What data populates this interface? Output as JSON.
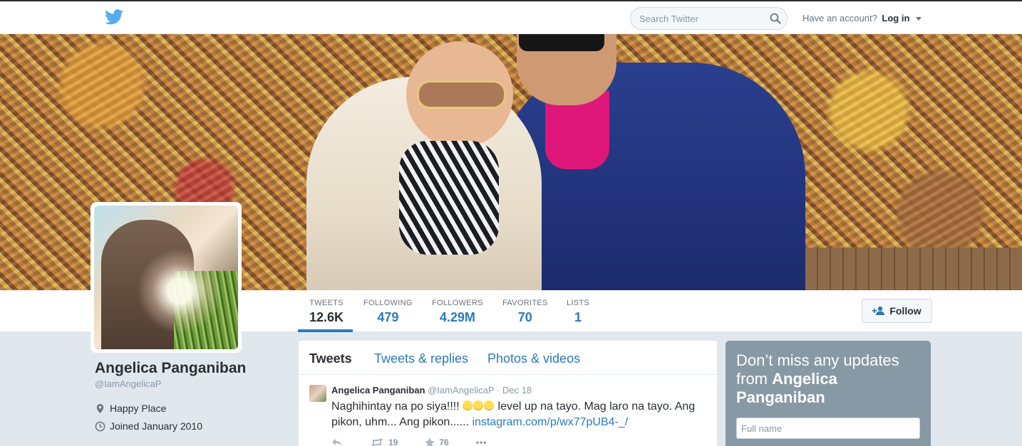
{
  "nav": {
    "search_placeholder": "Search Twitter",
    "have_account": "Have an account?",
    "login": "Log in"
  },
  "profile": {
    "name": "Angelica Panganiban",
    "handle": "@IamAngelicaP",
    "location": "Happy Place",
    "joined": "Joined January 2010",
    "follow_label": "Follow"
  },
  "stats": [
    {
      "label": "TWEETS",
      "value": "12.6K"
    },
    {
      "label": "FOLLOWING",
      "value": "479"
    },
    {
      "label": "FOLLOWERS",
      "value": "4.29M"
    },
    {
      "label": "FAVORITES",
      "value": "70"
    },
    {
      "label": "LISTS",
      "value": "1"
    }
  ],
  "timeline": {
    "tabs": [
      "Tweets",
      "Tweets & replies",
      "Photos & videos"
    ],
    "tweet": {
      "author": "Angelica Panganiban",
      "handle": "@IamAngelicaP",
      "dot": "·",
      "date": "Dec 18",
      "text_before": "Naghihintay na po siya!!!! ",
      "text_after": " level up na tayo. Mag laro na tayo. Ang pikon, uhm... Ang pikon...... ",
      "link": "instagram.com/p/wx77pUB4-_/",
      "retweets": "19",
      "favorites": "76",
      "more": "•••"
    }
  },
  "signup": {
    "line1": "Don’t miss any updates",
    "line2_prefix": "from ",
    "line2_name": "Angelica",
    "line3_name": "Panganiban",
    "fullname_placeholder": "Full name"
  },
  "colors": {
    "accent": "#2b7bb9",
    "text": "#292f33",
    "muted": "#8899a6",
    "background": "#e1e8ed"
  }
}
